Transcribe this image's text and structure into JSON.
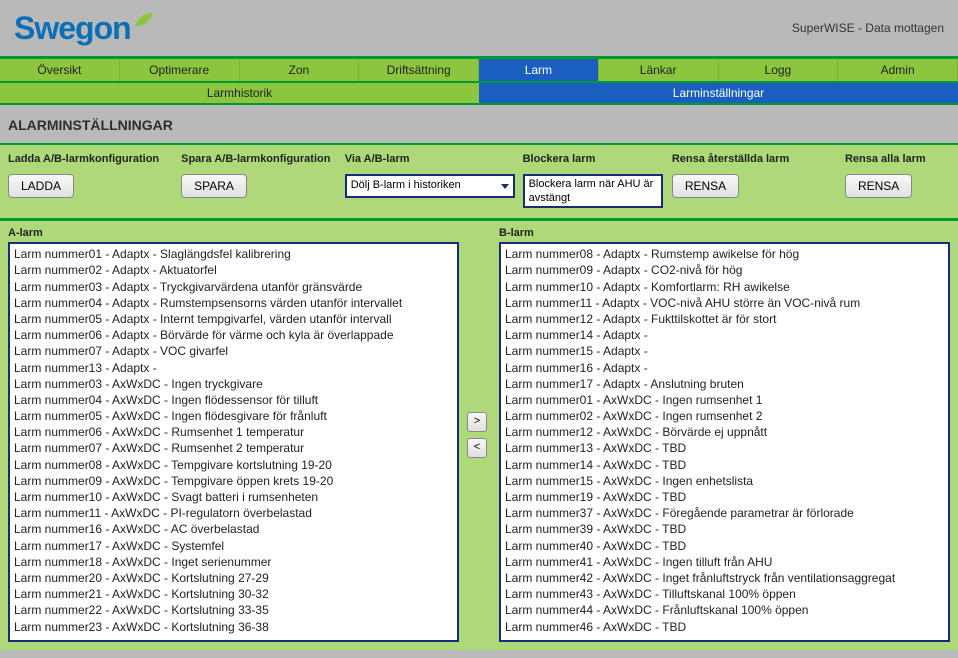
{
  "header": {
    "brand": "Swegon",
    "status": "SuperWISE - Data mottagen"
  },
  "tabs": [
    "Översikt",
    "Optimerare",
    "Zon",
    "Driftsättning",
    "Larm",
    "Länkar",
    "Logg",
    "Admin"
  ],
  "active_tab_index": 4,
  "subtabs": {
    "left": "Larmhistorik",
    "right": "Larminställningar"
  },
  "page_title": "ALARMINSTÄLLNINGAR",
  "config": {
    "load_label": "Ladda A/B-larmkonfiguration",
    "load_btn": "LADDA",
    "save_label": "Spara A/B-larmkonfiguration",
    "save_btn": "SPARA",
    "via_label": "Via A/B-larm",
    "via_option": "Dölj B-larm i historiken",
    "block_label": "Blockera larm",
    "block_option": "Blockera larm när AHU är avstängt",
    "reset_restored_label": "Rensa återställda larm",
    "reset_restored_btn": "RENSA",
    "reset_all_label": "Rensa alla larm",
    "reset_all_btn": "RENSA"
  },
  "transfer": {
    "right": ">",
    "left": "<"
  },
  "alarms": {
    "a_label": "A-larm",
    "b_label": "B-larm",
    "a_list": [
      "Larm nummer01 - Adaptx - Slaglängdsfel kalibrering",
      "Larm nummer02 - Adaptx - Aktuatorfel",
      "Larm nummer03 - Adaptx - Tryckgivarvärdena utanför gränsvärde",
      "Larm nummer04 - Adaptx - Rumstempsensorns värden utanför intervallet",
      "Larm nummer05 - Adaptx - Internt tempgivarfel, värden utanför intervall",
      "Larm nummer06 - Adaptx - Börvärde för värme och kyla är överlappade",
      "Larm nummer07 - Adaptx - VOC givarfel",
      "Larm nummer13 - Adaptx -",
      "Larm nummer03 - AxWxDC - Ingen tryckgivare",
      "Larm nummer04 - AxWxDC - Ingen flödessensor för tilluft",
      "Larm nummer05 - AxWxDC - Ingen flödesgivare för frånluft",
      "Larm nummer06 - AxWxDC - Rumsenhet 1 temperatur",
      "Larm nummer07 - AxWxDC - Rumsenhet 2 temperatur",
      "Larm nummer08 - AxWxDC - Tempgivare kortslutning 19-20",
      "Larm nummer09 - AxWxDC - Tempgivare öppen krets 19-20",
      "Larm nummer10 - AxWxDC - Svagt batteri i rumsenheten",
      "Larm nummer11 - AxWxDC - PI-regulatorn överbelastad",
      "Larm nummer16 - AxWxDC - AC överbelastad",
      "Larm nummer17 - AxWxDC - Systemfel",
      "Larm nummer18 - AxWxDC - Inget serienummer",
      "Larm nummer20 - AxWxDC - Kortslutning 27-29",
      "Larm nummer21 - AxWxDC - Kortslutning 30-32",
      "Larm nummer22 - AxWxDC - Kortslutning 33-35",
      "Larm nummer23 - AxWxDC - Kortslutning 36-38"
    ],
    "b_list": [
      "Larm nummer08 - Adaptx - Rumstemp awikelse för hög",
      "Larm nummer09 - Adaptx - CO2-nivå för hög",
      "Larm nummer10 - Adaptx - Komfortlarm: RH awikelse",
      "Larm nummer11 - Adaptx - VOC-nivå AHU större än VOC-nivå rum",
      "Larm nummer12 - Adaptx - Fukttilskottet är för stort",
      "Larm nummer14 - Adaptx -",
      "Larm nummer15 - Adaptx -",
      "Larm nummer16 - Adaptx -",
      "Larm nummer17 - Adaptx - Anslutning bruten",
      "Larm nummer01 - AxWxDC - Ingen rumsenhet 1",
      "Larm nummer02 - AxWxDC - Ingen rumsenhet 2",
      "Larm nummer12 - AxWxDC - Börvärde ej uppnått",
      "Larm nummer13 - AxWxDC - TBD",
      "Larm nummer14 - AxWxDC - TBD",
      "Larm nummer15 - AxWxDC - Ingen enhetslista",
      "Larm nummer19 - AxWxDC - TBD",
      "Larm nummer37 - AxWxDC - Föregående parametrar är förlorade",
      "Larm nummer39 - AxWxDC - TBD",
      "Larm nummer40 - AxWxDC - TBD",
      "Larm nummer41 - AxWxDC - Ingen tilluft från AHU",
      "Larm nummer42 - AxWxDC - Inget frånluftstryck från ventilationsaggregat",
      "Larm nummer43 - AxWxDC - Tilluftskanal 100% öppen",
      "Larm nummer44 - AxWxDC - Frånluftskanal 100% öppen",
      "Larm nummer46 - AxWxDC - TBD"
    ]
  }
}
